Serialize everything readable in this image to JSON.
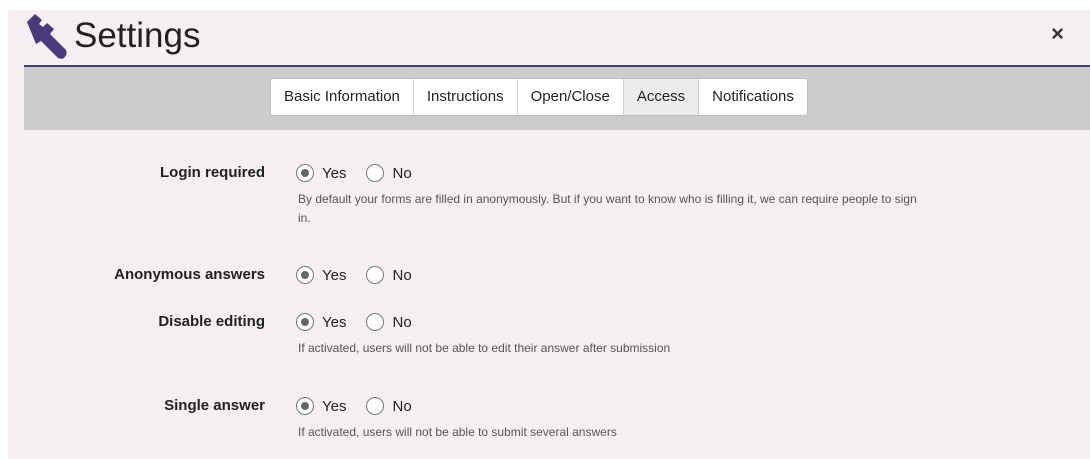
{
  "header": {
    "title": "Settings",
    "icon": "wrench-icon",
    "icon_color": "#4b3a7a",
    "close_label": "×"
  },
  "tabs": [
    {
      "label": "Basic Information",
      "active": false
    },
    {
      "label": "Instructions",
      "active": false
    },
    {
      "label": "Open/Close",
      "active": false
    },
    {
      "label": "Access",
      "active": true
    },
    {
      "label": "Notifications",
      "active": false
    }
  ],
  "settings": [
    {
      "label": "Login required",
      "options": [
        "Yes",
        "No"
      ],
      "selected": "Yes",
      "help": "By default your forms are filled in anonymously. But if you want to know who is filling it, we can require people to sign in."
    },
    {
      "label": "Anonymous answers",
      "options": [
        "Yes",
        "No"
      ],
      "selected": "Yes",
      "help": ""
    },
    {
      "label": "Disable editing",
      "options": [
        "Yes",
        "No"
      ],
      "selected": "Yes",
      "help": "If activated, users will not be able to edit their answer after submission"
    },
    {
      "label": "Single answer",
      "options": [
        "Yes",
        "No"
      ],
      "selected": "Yes",
      "help": "If activated, users will not be able to submit several answers"
    }
  ],
  "colors": {
    "accent": "#4b3a7a",
    "tabbar": "#cccccc",
    "background": "#f5eff4"
  }
}
